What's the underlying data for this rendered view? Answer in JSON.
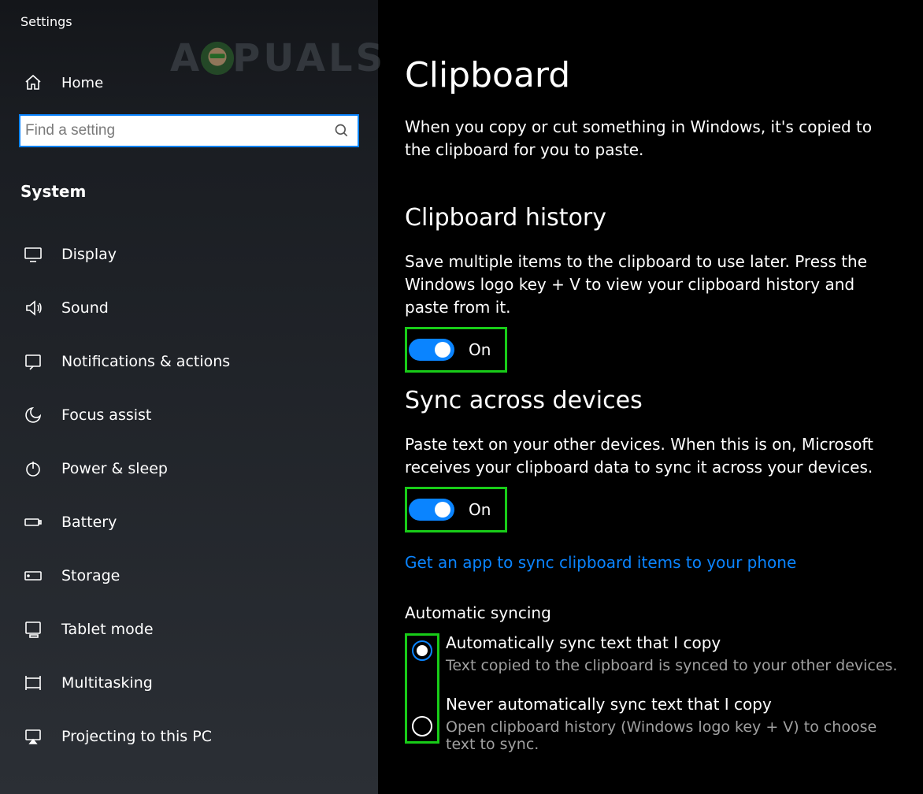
{
  "app_title": "Settings",
  "watermark_text_left": "A",
  "watermark_text_right": "PUALS",
  "home_label": "Home",
  "search": {
    "placeholder": "Find a setting"
  },
  "category": "System",
  "nav": [
    {
      "icon": "display",
      "label": "Display"
    },
    {
      "icon": "sound",
      "label": "Sound"
    },
    {
      "icon": "notifications",
      "label": "Notifications & actions"
    },
    {
      "icon": "focus",
      "label": "Focus assist"
    },
    {
      "icon": "power",
      "label": "Power & sleep"
    },
    {
      "icon": "battery",
      "label": "Battery"
    },
    {
      "icon": "storage",
      "label": "Storage"
    },
    {
      "icon": "tablet",
      "label": "Tablet mode"
    },
    {
      "icon": "multitask",
      "label": "Multitasking"
    },
    {
      "icon": "projecting",
      "label": "Projecting to this PC"
    }
  ],
  "page": {
    "title": "Clipboard",
    "lead": "When you copy or cut something in Windows, it's copied to the clipboard for you to paste.",
    "history": {
      "title": "Clipboard history",
      "desc": "Save multiple items to the clipboard to use later. Press the Windows logo key + V to view your clipboard history and paste from it.",
      "state": "On"
    },
    "sync": {
      "title": "Sync across devices",
      "desc": "Paste text on your other devices. When this is on, Microsoft receives your clipboard data to sync it across your devices.",
      "state": "On",
      "link": "Get an app to sync clipboard items to your phone",
      "auto_title": "Automatic syncing",
      "options": [
        {
          "label": "Automatically sync text that I copy",
          "desc": "Text copied to the clipboard is synced to your other devices.",
          "selected": true
        },
        {
          "label": "Never automatically sync text that I copy",
          "desc": "Open clipboard history (Windows logo key + V) to choose text to sync.",
          "selected": false
        }
      ]
    }
  }
}
